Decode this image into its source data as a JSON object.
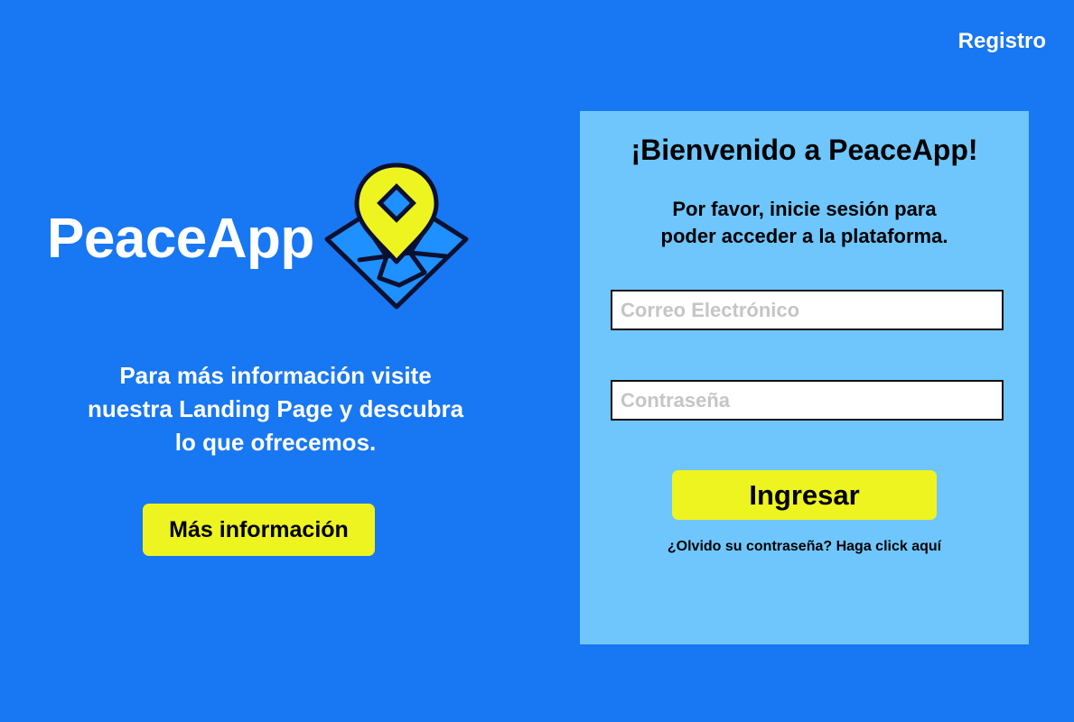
{
  "header": {
    "register_label": "Registro"
  },
  "brand": {
    "name": "PeaceApp",
    "logo_icon": "map-pin-icon"
  },
  "promo": {
    "text_line1": "Para más información visite",
    "text_line2": "nuestra Landing Page y descubra",
    "text_line3": "lo que ofrecemos.",
    "button_label": "Más información"
  },
  "login": {
    "title": "¡Bienvenido a PeaceApp!",
    "instructions_line1": "Por favor, inicie sesión para",
    "instructions_line2": "poder acceder a la plataforma.",
    "email_placeholder": "Correo Electrónico",
    "password_placeholder": "Contraseña",
    "submit_label": "Ingresar",
    "forgot_label": "¿Olvido su contraseña? Haga click aquí"
  },
  "colors": {
    "background": "#1877F2",
    "panel": "#6FC6FD",
    "accent": "#EEF420",
    "text_dark": "#000000",
    "text_light": "#FFFFFF"
  }
}
